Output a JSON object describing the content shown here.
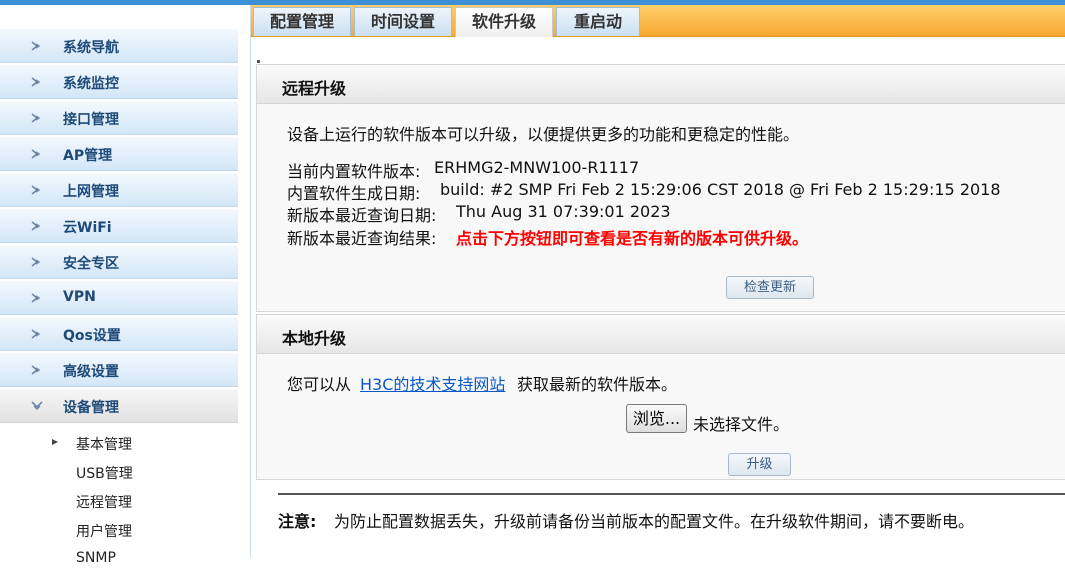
{
  "sidebar": {
    "items": [
      {
        "label": "系统导航"
      },
      {
        "label": "系统监控"
      },
      {
        "label": "接口管理"
      },
      {
        "label": "AP管理"
      },
      {
        "label": "上网管理"
      },
      {
        "label": "云WiFi"
      },
      {
        "label": "安全专区"
      },
      {
        "label": "VPN"
      },
      {
        "label": "Qos设置"
      },
      {
        "label": "高级设置"
      },
      {
        "label": "设备管理"
      }
    ],
    "sub_items": [
      {
        "label": "基本管理"
      },
      {
        "label": "USB管理"
      },
      {
        "label": "远程管理"
      },
      {
        "label": "用户管理"
      },
      {
        "label": "SNMP"
      }
    ]
  },
  "tabs": [
    {
      "label": "配置管理"
    },
    {
      "label": "时间设置"
    },
    {
      "label": "软件升级"
    },
    {
      "label": "重启动"
    }
  ],
  "remote": {
    "title": "远程升级",
    "desc": "设备上运行的软件版本可以升级，以便提供更多的功能和更稳定的性能。",
    "version_label": "当前内置软件版本:",
    "version_value": "ERHMG2-MNW100-R1117",
    "build_label": "内置软件生成日期:",
    "build_value": "build: #2 SMP Fri Feb 2 15:29:06 CST 2018 @ Fri Feb 2 15:29:15 2018",
    "query_date_label": "新版本最近查询日期:",
    "query_date_value": "Thu Aug 31 07:39:01 2023",
    "query_result_label": "新版本最近查询结果:",
    "query_result_value": "点击下方按钮即可查看是否有新的版本可供升级。",
    "check_button": "检查更新"
  },
  "local": {
    "title": "本地升级",
    "prefix": "您可以从",
    "link": "H3C的技术支持网站",
    "suffix": "获取最新的软件版本。",
    "browse_button": "浏览...",
    "no_file": "未选择文件。",
    "upgrade_button": "升级"
  },
  "notice": {
    "label": "注意:",
    "text": "为防止配置数据丢失，升级前请备份当前版本的配置文件。在升级软件期间，请不要断电。"
  },
  "colors": {
    "tab_bar": "#f6a832",
    "nav_text": "#1d4a78",
    "warning": "#ff0000",
    "link": "#0a58c7"
  }
}
